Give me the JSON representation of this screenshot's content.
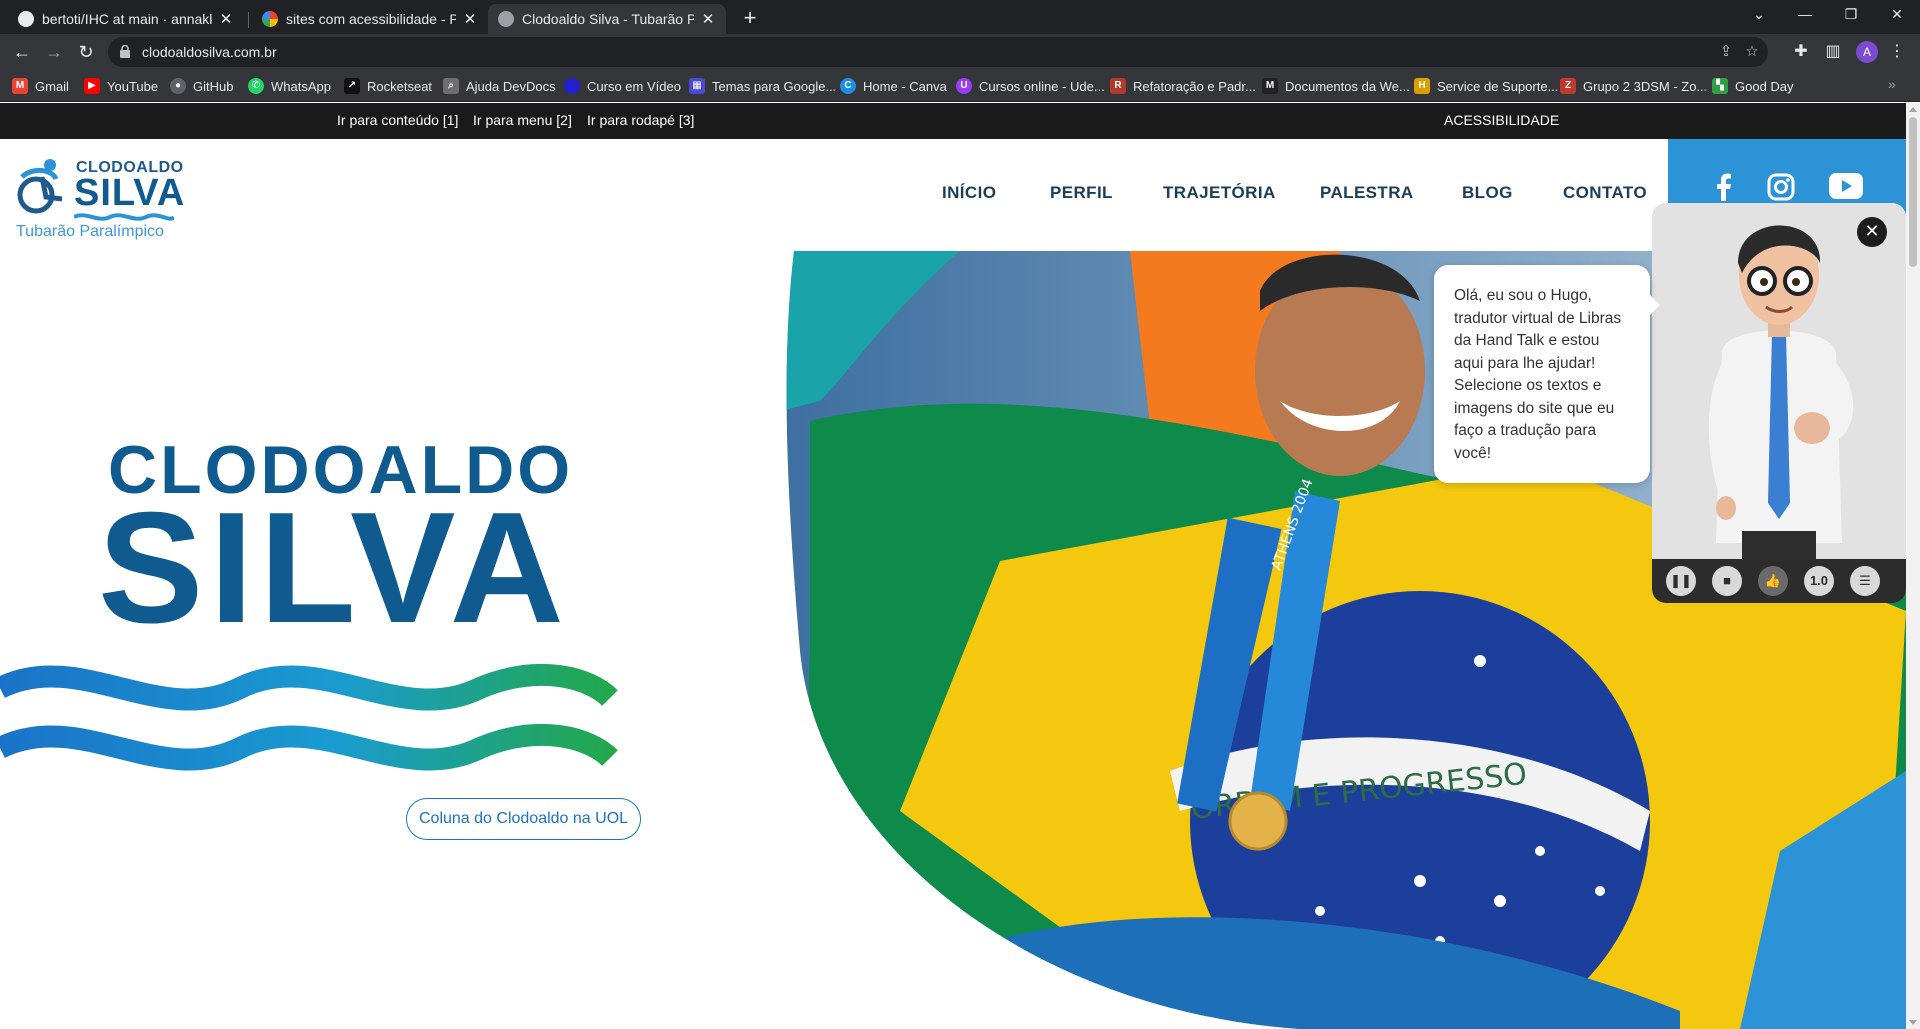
{
  "browser": {
    "tabs": [
      {
        "title": "bertoti/IHC at main · annakks/be",
        "icon": "github-icon"
      },
      {
        "title": "sites com acessibilidade - Pesqui",
        "icon": "google-icon"
      },
      {
        "title": "Clodoaldo Silva - Tubarão Paralím",
        "icon": "globe-icon",
        "active": true
      }
    ],
    "url": "clodoaldosilva.com.br",
    "avatar_letter": "A",
    "bookmarks": [
      {
        "label": "Gmail",
        "icon": "gmail-icon",
        "color": "#ea4335"
      },
      {
        "label": "YouTube",
        "icon": "youtube-icon",
        "color": "#ff0000"
      },
      {
        "label": "GitHub",
        "icon": "github-icon",
        "color": "#5f6368"
      },
      {
        "label": "WhatsApp",
        "icon": "whatsapp-icon",
        "color": "#25d366"
      },
      {
        "label": "Rocketseat",
        "icon": "rocketseat-icon",
        "color": "#111111"
      },
      {
        "label": "Ajuda DevDocs",
        "icon": "devdocs-icon",
        "color": "#6e6e6e"
      },
      {
        "label": "Curso em Vídeo",
        "icon": "cursoemvideo-icon",
        "color": "#2222cc"
      },
      {
        "label": "Temas para Google...",
        "icon": "themes-icon",
        "color": "#4a4ad6"
      },
      {
        "label": "Home - Canva",
        "icon": "canva-icon",
        "color": "#1b8fe6"
      },
      {
        "label": "Cursos online - Ude...",
        "icon": "udemy-icon",
        "color": "#9b3cf0"
      },
      {
        "label": "Refatoração e Padr...",
        "icon": "refactoring-icon",
        "color": "#b23a2a"
      },
      {
        "label": "Documentos da We...",
        "icon": "mdn-icon",
        "color": "#222222"
      },
      {
        "label": "Service de Suporte...",
        "icon": "support-icon",
        "color": "#d8a000"
      },
      {
        "label": "Grupo 2 3DSM - Zo...",
        "icon": "zoho-icon",
        "color": "#c0392b"
      },
      {
        "label": "Good Day",
        "icon": "goodday-icon",
        "color": "#2ea043"
      }
    ]
  },
  "site": {
    "skip_links": [
      "Ir para conteúdo [1]",
      "Ir para menu [2]",
      "Ir para rodapé [3]"
    ],
    "accessibility_label": "ACESSIBILIDADE",
    "logo": {
      "line1": "CLODOALDO",
      "line2": "SILVA",
      "tagline": "Tubarão Paralímpico"
    },
    "menu": [
      "INÍCIO",
      "PERFIL",
      "TRAJETÓRIA",
      "PALESTRA",
      "BLOG",
      "CONTATO"
    ],
    "social": [
      "facebook-icon",
      "instagram-icon",
      "youtube-icon"
    ],
    "hero": {
      "title_1": "CLODOALDO",
      "title_2": "SILVA",
      "button": "Coluna do Clodoaldo na UOL"
    },
    "flag_text": "ORDEM E PROGRESSO",
    "medal_text": "ATHENS 2004"
  },
  "handtalk": {
    "message": "Olá, eu sou o Hugo, tradutor virtual de Libras da Hand Talk e estou aqui para lhe ajudar! Selecione os textos e imagens do site que eu faço a tradução para você!",
    "speed": "1.0"
  },
  "colors": {
    "brand_blue": "#0f5a8f",
    "accent_blue": "#2c94d6",
    "wave_green": "#22a84a"
  }
}
